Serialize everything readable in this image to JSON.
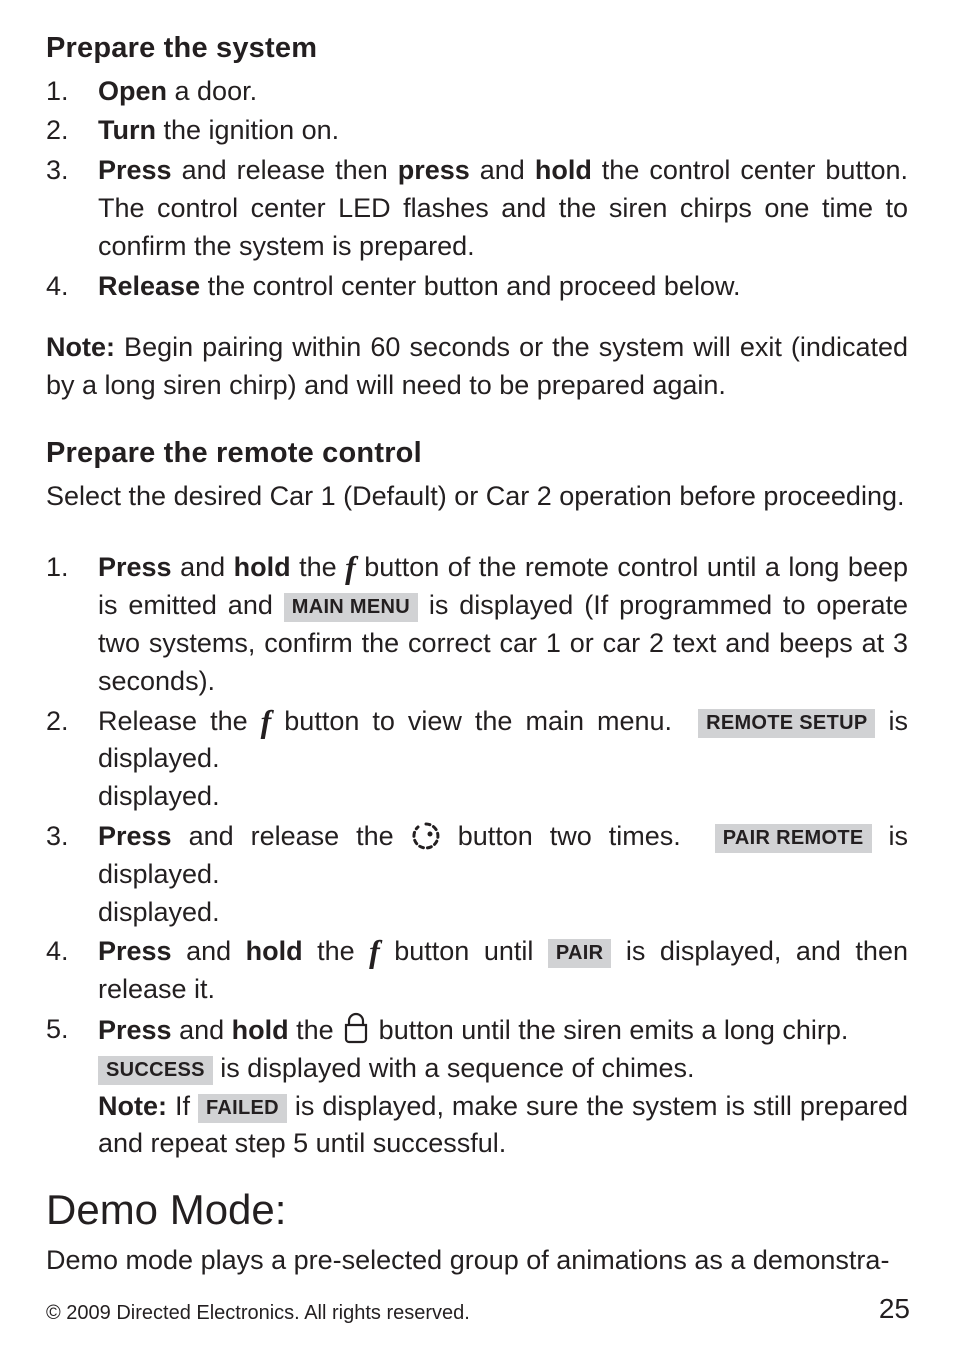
{
  "sections": {
    "prepare_system": {
      "heading": "Prepare the system",
      "items": {
        "i1": {
          "num": "1.",
          "open": "Open",
          "rest": " a door."
        },
        "i2": {
          "num": "2.",
          "turn": "Turn",
          "rest": " the ignition on."
        },
        "i3": {
          "num": "3.",
          "press": "Press",
          "mid1": " and release then ",
          "press2": "press",
          "mid2": " and ",
          "hold": "hold",
          "rest1": " the control center button. The control center LED flashes and the siren chirps one time to confirm the system is prepared."
        },
        "i4": {
          "num": "4.",
          "release": "Release",
          "rest": " the control center button and proceed below."
        }
      }
    },
    "note1": {
      "label": "Note:",
      "text": " Begin pairing within 60 seconds or the system will exit (indicated by a long siren chirp) and will need to be prepared again."
    },
    "prepare_remote": {
      "heading": "Prepare the remote control",
      "intro": "Select the desired Car 1 (Default) or Car 2 operation before proceeding.",
      "items": {
        "r1": {
          "num": "1.",
          "press": "Press",
          "mid1": " and ",
          "hold": "hold",
          "mid2": " the ",
          "mid3": " button of the remote control until a long beep is emitted and ",
          "label": "MAIN MENU",
          "rest": " is displayed (If programmed to operate two systems, confirm the correct car 1 or car 2 text and beeps at 3 seconds)."
        },
        "r2": {
          "num": "2.",
          "t1": "Release the ",
          "t2": " button to view the main menu.",
          "label": "REMOTE SETUP",
          "t3": " is displayed."
        },
        "r3": {
          "num": "3.",
          "press": "Press",
          "t1": " and release the ",
          "t2": " button two times.",
          "label": "PAIR REMOTE",
          "t3": " is displayed."
        },
        "r4": {
          "num": "4.",
          "press": "Press",
          "t1": " and ",
          "hold": "hold",
          "t2": " the ",
          "t3": " button until ",
          "label": "PAIR",
          "t4": " is displayed, and then release it."
        },
        "r5": {
          "num": "5.",
          "press": "Press",
          "t1": " and ",
          "hold": "hold",
          "t2": " the ",
          "t3": " button until the siren emits a long chirp.",
          "label_success": "SUCCESS",
          "t4": " is displayed with a sequence of chimes.",
          "note_label": "Note:",
          "t5": " If ",
          "label_failed": "FAILED",
          "t6": " is displayed, make sure the system is still prepared and repeat step 5 until successful."
        }
      }
    },
    "demo": {
      "heading": "Demo Mode:",
      "text": "Demo mode plays a pre-selected group of animations as a demonstra-"
    }
  },
  "icons": {
    "f": "f"
  },
  "footer": {
    "copyright": "© 2009 Directed Electronics. All rights reserved.",
    "page": "25"
  }
}
